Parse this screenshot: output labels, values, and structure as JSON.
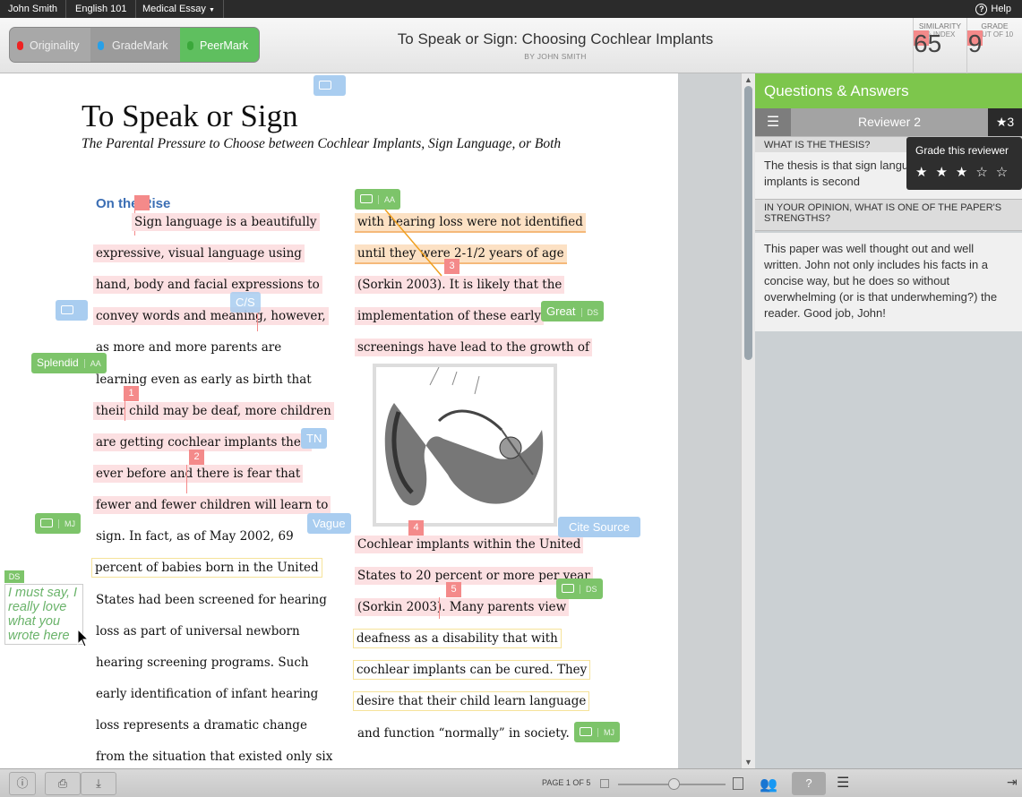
{
  "topbar": {
    "user": "John Smith",
    "course": "English 101",
    "assignment": "Medical Essay",
    "help": "Help"
  },
  "modes": {
    "originality": "Originality",
    "grademark": "GradeMark",
    "peermark": "PeerMark"
  },
  "doc": {
    "title": "To Speak or Sign: Choosing Cochlear Implants",
    "by": "BY JOHN SMITH"
  },
  "similarity": {
    "label": "SIMILARITY",
    "value": "65",
    "sub": "% INDEX"
  },
  "grade": {
    "label": "GRADE",
    "value": "9",
    "sub": "OUT OF 10"
  },
  "paper": {
    "title": "To Speak or Sign",
    "subtitle": "The Parental Pressure to Choose between Cochlear Implants, Sign Language, or Both",
    "heading": "On the Rise",
    "left": [
      "Sign language is a beautifully",
      "expressive, visual language using",
      "hand, body and facial expressions to",
      "convey words and meaning, however,",
      "as more and more parents are",
      "learning even as early as birth that",
      "their child may be deaf, more children",
      "are getting cochlear implants then",
      "ever before and there is fear that",
      "fewer and fewer children will learn to",
      "sign.   In fact, as of May 2002, 69",
      "percent of babies born in the United",
      "States had been screened for hearing",
      "loss as part of universal newborn",
      "hearing screening programs. Such",
      "early identification of infant hearing",
      "loss represents a dramatic change",
      "from the situation that existed only six"
    ],
    "right_top": [
      "with hearing loss were not identified",
      "until they were 2-1/2 years of age",
      "(Sorkin 2003).  It is likely that the",
      "implementation of these early",
      "screenings have lead to the growth of"
    ],
    "right_bottom": [
      "Cochlear implants within the United",
      "States to 20 percent or more per year",
      "(Sorkin 2003).  Many parents view",
      "deafness as a disability that with",
      "cochlear implants can be cured.  They",
      "desire that their child learn language",
      "and function “normally” in society."
    ]
  },
  "marks": {
    "splendid": "Splendid",
    "aa": "AA",
    "great": "Great",
    "ds": "DS",
    "cs": "C/S",
    "tn": "TN",
    "vague": "Vague",
    "cite": "Cite Source",
    "mj": "MJ",
    "n1": "1",
    "n2": "2",
    "n3": "3",
    "n4": "4",
    "n5": "5"
  },
  "note": {
    "tag": "DS",
    "text": "I must say, I really love what you wrote here"
  },
  "panel": {
    "title": "Questions & Answers",
    "reviewer": "Reviewer 2",
    "stars": "★3",
    "q1": "WHAT IS THE THESIS?",
    "a1": "The thesis is that sign language whereas implants is second",
    "q2": "IN YOUR OPINION, WHAT IS ONE OF THE PAPER'S STRENGTHS?",
    "a2": "This paper was well thought out and well written. John not only includes his facts in a concise way, but he does so without overwhelming (or is that underwheming?) the reader. Good job, John!",
    "tooltip": "Grade this reviewer",
    "rating_stars": "★★★☆☆"
  },
  "bottom": {
    "page": "PAGE 1 OF 5"
  },
  "rating": {
    "value": 3,
    "max": 5
  }
}
